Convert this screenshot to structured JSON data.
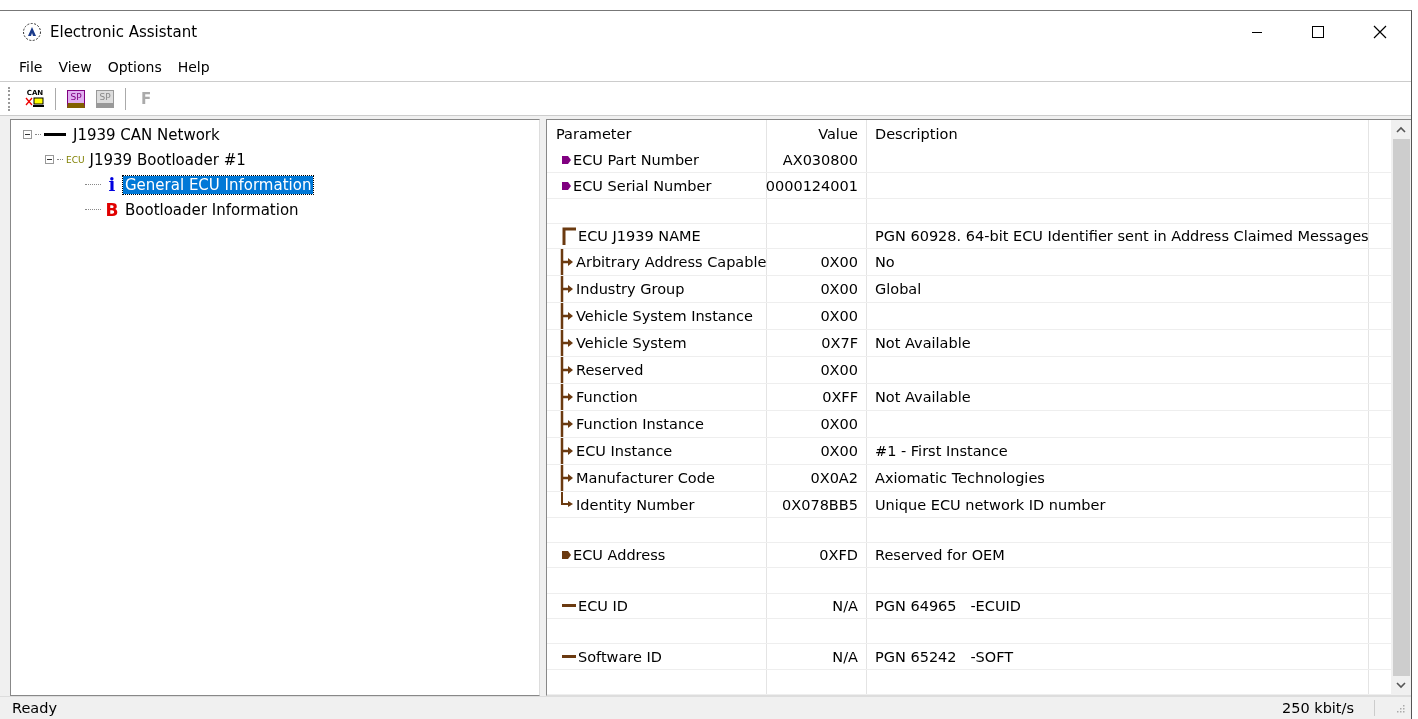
{
  "window": {
    "title": "Electronic Assistant"
  },
  "menu": [
    "File",
    "View",
    "Options",
    "Help"
  ],
  "toolbar": [
    {
      "kind": "can",
      "label": "CAN",
      "disabled": false
    },
    {
      "kind": "sp_open",
      "label": "SP",
      "disabled": false
    },
    {
      "kind": "sp_save",
      "label": "SP",
      "disabled": true
    },
    {
      "kind": "flash",
      "label": "F",
      "disabled": true
    }
  ],
  "tree": [
    {
      "kind": "network",
      "label": "J1939 CAN Network",
      "expanded": true,
      "selected": false,
      "children": [
        {
          "kind": "ecu",
          "glyph": "ECU",
          "label": "J1939 Bootloader #1",
          "expanded": true,
          "selected": false,
          "children": [
            {
              "kind": "info",
              "glyph": "i",
              "label": "General ECU Information",
              "selected": true
            },
            {
              "kind": "bootloader",
              "glyph": "B",
              "label": "Bootloader Information",
              "selected": false
            }
          ]
        }
      ]
    }
  ],
  "table": {
    "columns": [
      "Parameter",
      "Value",
      "Description"
    ],
    "rows": [
      {
        "kind": "tag",
        "color": "#800080",
        "parameter": "ECU Part Number",
        "value": "AX030800"
      },
      {
        "kind": "tag",
        "color": "#800080",
        "parameter": "ECU Serial Number",
        "value": "0000124001"
      },
      {
        "kind": "blank"
      },
      {
        "kind": "head",
        "parameter": "ECU J1939 NAME",
        "description": "PGN 60928. 64-bit ECU Identifier sent in Address Claimed Messages"
      },
      {
        "kind": "branch",
        "parameter": "Arbitrary Address Capable",
        "value": "0X00",
        "description": "No"
      },
      {
        "kind": "branch",
        "parameter": "Industry Group",
        "value": "0X00",
        "description": "Global"
      },
      {
        "kind": "branch",
        "parameter": "Vehicle System Instance",
        "value": "0X00"
      },
      {
        "kind": "branch",
        "parameter": "Vehicle System",
        "value": "0X7F",
        "description": "Not Available"
      },
      {
        "kind": "branch",
        "parameter": "Reserved",
        "value": "0X00"
      },
      {
        "kind": "branch",
        "parameter": "Function",
        "value": "0XFF",
        "description": "Not Available"
      },
      {
        "kind": "branch",
        "parameter": "Function Instance",
        "value": "0X00"
      },
      {
        "kind": "branch",
        "parameter": "ECU Instance",
        "value": "0X00",
        "description": "#1 - First Instance"
      },
      {
        "kind": "branch",
        "parameter": "Manufacturer Code",
        "value": "0X0A2",
        "description": "Axiomatic Technologies"
      },
      {
        "kind": "end",
        "parameter": "Identity Number",
        "value": "0X078BB5",
        "description": "Unique ECU network ID number"
      },
      {
        "kind": "blank"
      },
      {
        "kind": "tag",
        "color": "#6b3a10",
        "parameter": "ECU Address",
        "value": "0XFD",
        "description": "Reserved for OEM"
      },
      {
        "kind": "blank"
      },
      {
        "kind": "dash",
        "parameter": "ECU ID",
        "value": "N/A",
        "description": "PGN 64965   -ECUID"
      },
      {
        "kind": "blank"
      },
      {
        "kind": "dash",
        "parameter": "Software ID",
        "value": "N/A",
        "description": "PGN 65242   -SOFT"
      },
      {
        "kind": "blank"
      }
    ]
  },
  "status_bar": {
    "message": "Ready",
    "rate": "250 kbit/s"
  }
}
